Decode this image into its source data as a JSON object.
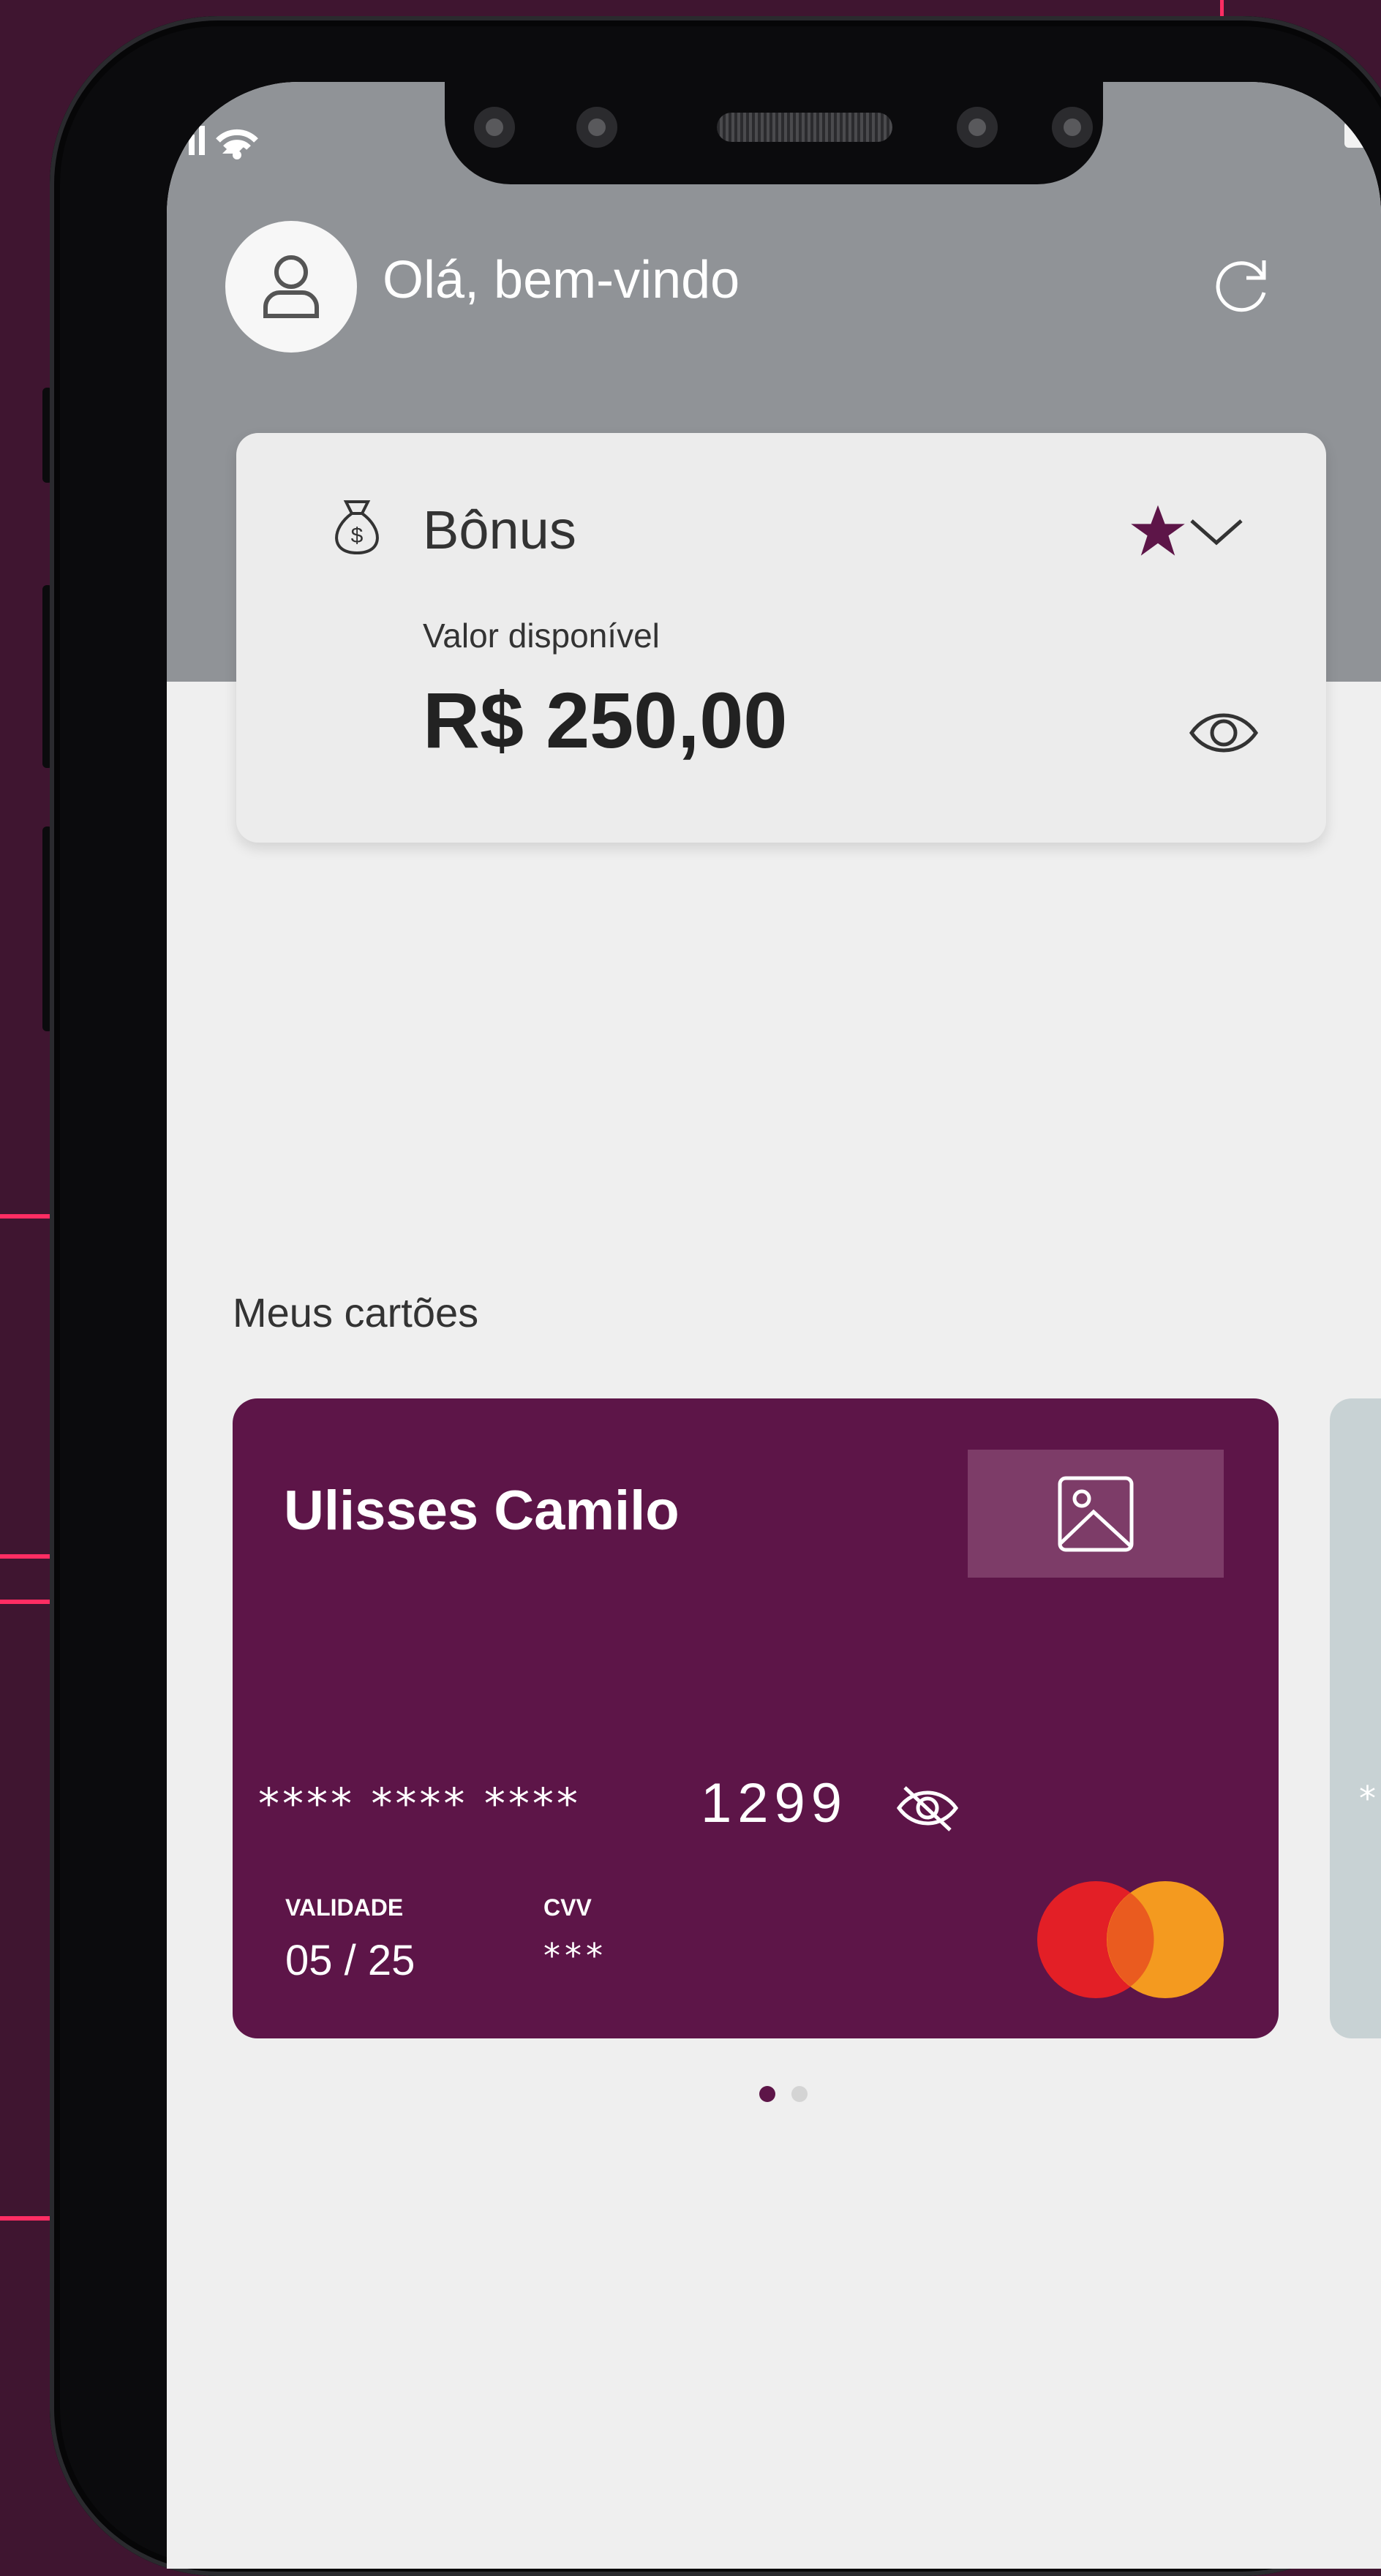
{
  "header": {
    "greeting": "Olá, bem-vindo"
  },
  "bonus_card": {
    "title": "Bônus",
    "label": "Valor disponível",
    "amount": "R$ 250,00"
  },
  "cards_section": {
    "title": "Meus cartões"
  },
  "credit_card": {
    "holder_name": "Ulisses Camilo",
    "masked_digits": "**** **** ****",
    "last_digits": "1299",
    "validade_label": "VALIDADE",
    "validade_value": "05 / 25",
    "cvv_label": "CVV",
    "cvv_value": "***",
    "brand_icon": "mastercard-logo"
  },
  "next_card": {
    "masked_hint": "*"
  },
  "pager": {
    "total_pages": 2,
    "active_page": 1
  },
  "colors": {
    "brand_primary": "#5d1548",
    "star_accent": "#5d1548",
    "background_outer": "#3f1530",
    "accent_line": "#ff2d63",
    "header_band": "#909397",
    "page_background": "#efefef"
  },
  "icons": [
    "user-icon",
    "refresh-icon",
    "money-bag-icon",
    "star-icon",
    "chevron-down-icon",
    "eye-icon",
    "image-icon",
    "eye-off-icon",
    "mastercard-logo"
  ]
}
